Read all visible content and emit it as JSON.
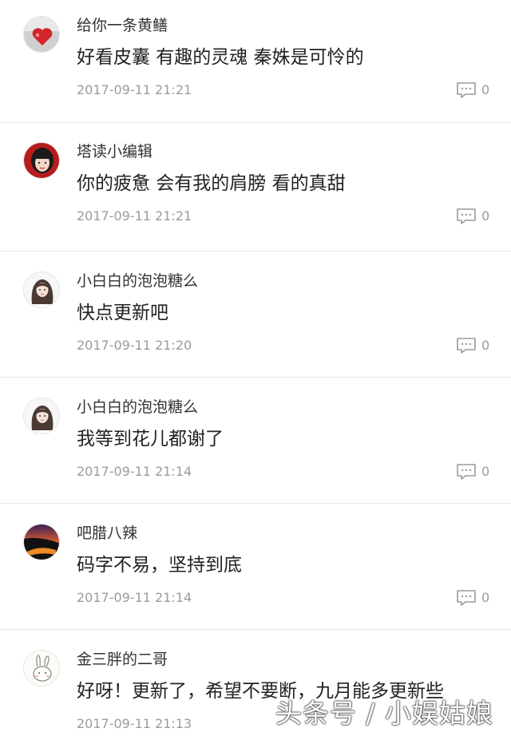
{
  "comments": [
    {
      "username": "给你一条黄鳝",
      "content": "好看皮囊 有趣的灵魂 秦姝是可怜的",
      "time": "2017-09-11 21:21",
      "reply_count": "0",
      "avatar_icon": "red-heart-avatar-icon"
    },
    {
      "username": "塔读小编辑",
      "content": "你的疲惫 会有我的肩膀 看的真甜",
      "time": "2017-09-11 21:21",
      "reply_count": "0",
      "avatar_icon": "girl-portrait-avatar-icon"
    },
    {
      "username": "小白白的泡泡糖么",
      "content": "快点更新吧",
      "time": "2017-09-11 21:20",
      "reply_count": "0",
      "avatar_icon": "girl-long-hair-avatar-icon"
    },
    {
      "username": "小白白的泡泡糖么",
      "content": "我等到花儿都谢了",
      "time": "2017-09-11 21:14",
      "reply_count": "0",
      "avatar_icon": "girl-long-hair-avatar-icon"
    },
    {
      "username": "吧腊八辣",
      "content": "码字不易，坚持到底",
      "time": "2017-09-11 21:14",
      "reply_count": "0",
      "avatar_icon": "sunset-avatar-icon"
    },
    {
      "username": "金三胖的二哥",
      "content": "好呀！更新了，希望不要断，九月能多更新些",
      "time": "2017-09-11 21:13",
      "reply_count": "",
      "avatar_icon": "rabbit-sketch-avatar-icon"
    }
  ],
  "watermark": "头条号 / 小娱姑娘",
  "colors": {
    "username": "#333333",
    "content": "#222222",
    "meta": "#9b9b9b",
    "divider": "#e8e8e8"
  }
}
